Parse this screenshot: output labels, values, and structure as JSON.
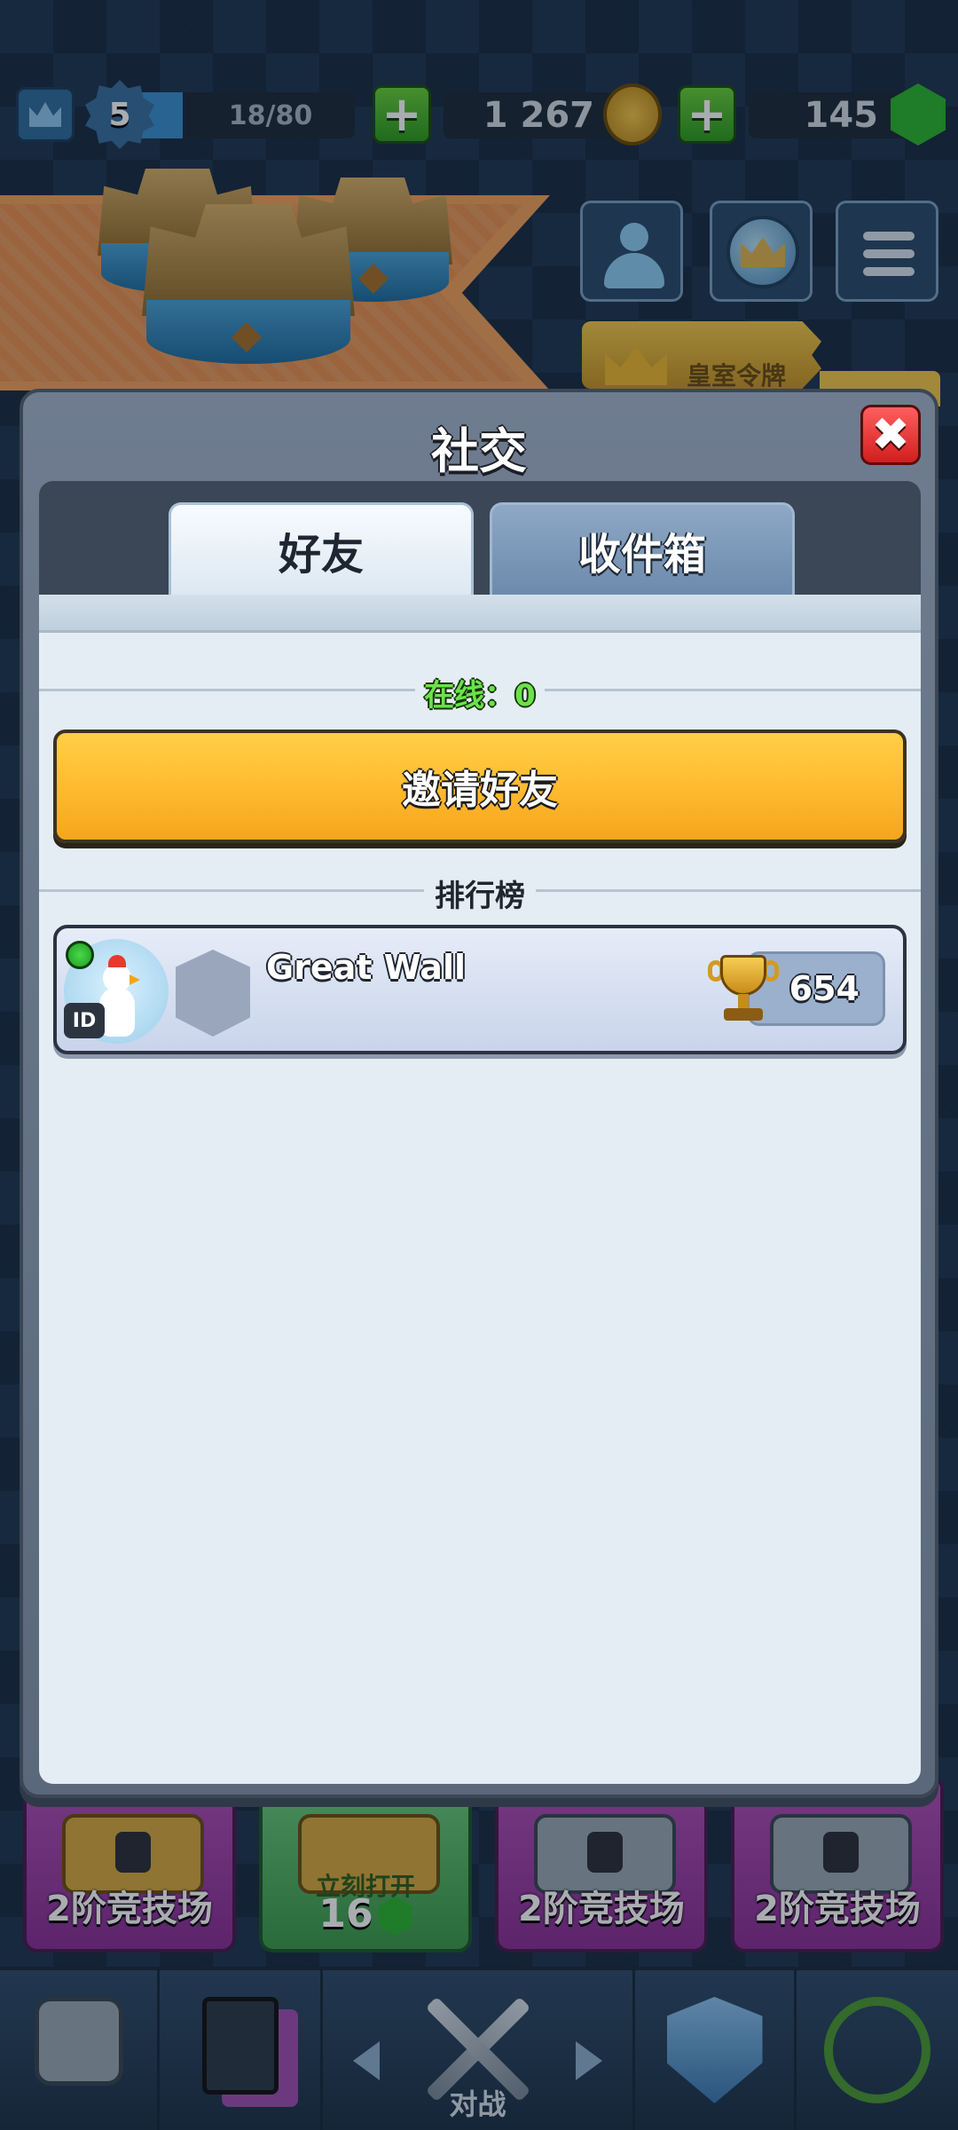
{
  "topbar": {
    "level": "5",
    "xp_text": "18/80",
    "xp_progress": 0.225,
    "gold": "1 267",
    "gems": "145"
  },
  "top_buttons": {
    "royal_pass_label": "皇室令牌"
  },
  "dialog": {
    "title": "社交",
    "close_symbol": "✖",
    "tabs": [
      {
        "label": "好友",
        "active": true
      },
      {
        "label": "收件箱",
        "active": false
      }
    ],
    "online_label": "在线：0",
    "invite_button": "邀请好友",
    "leaderboard_label": "排行榜",
    "friends": [
      {
        "name": "Great Wall",
        "trophies": "654",
        "online": true,
        "id_badge": "ID"
      }
    ]
  },
  "chests": [
    {
      "label": "2阶竞技场",
      "type": "gold-chest-icon"
    },
    {
      "open_now": "立刻打开",
      "gem_cost": "16",
      "type": "gold-chest-icon"
    },
    {
      "label": "2阶竞技场",
      "type": "silver-chest-icon"
    },
    {
      "label": "2阶竞技场",
      "type": "silver-chest-icon"
    }
  ],
  "bottom_nav": {
    "battle_label": "对战"
  },
  "colors": {
    "invite_button": "#ffb92e",
    "close_button": "#e02a2a",
    "online_text": "#6be24a",
    "content_bg": "#e4edf3"
  }
}
